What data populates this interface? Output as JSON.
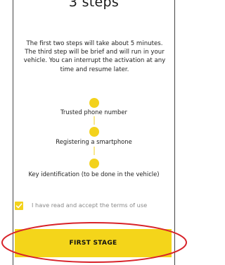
{
  "header": {
    "title": "3 steps"
  },
  "intro": {
    "text": "The first two steps will take about 5 minutes. The third step will be brief and will run in your vehicle. You can interrupt the activation at any time and resume later."
  },
  "steps": [
    {
      "label": "Trusted phone number"
    },
    {
      "label": "Registering a smartphone"
    },
    {
      "label": "Key identification (to be done in the vehicle)"
    }
  ],
  "terms": {
    "label": "I have read and accept the terms of use",
    "checked": true
  },
  "actions": {
    "first_stage_label": "FIRST STAGE"
  },
  "colors": {
    "accent": "#f3d21c",
    "highlight": "#d8232a"
  }
}
